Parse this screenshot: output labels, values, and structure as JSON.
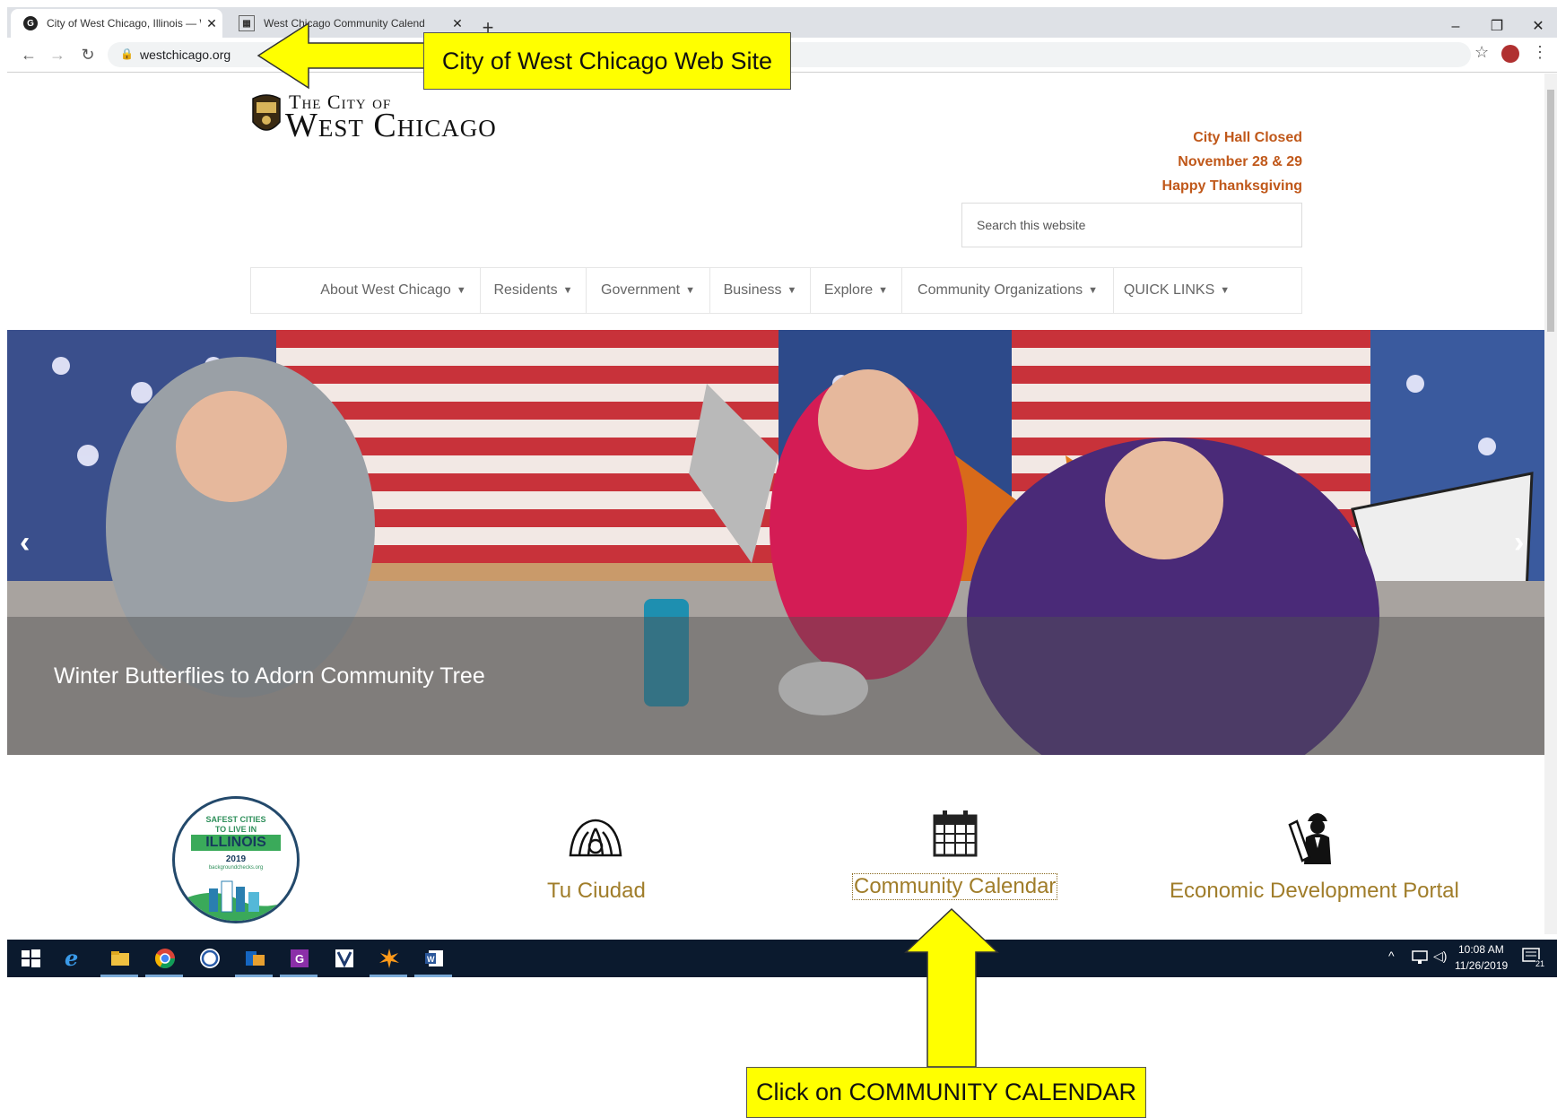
{
  "browser": {
    "tabs": [
      {
        "title": "City of West Chicago, Illinois — W",
        "active": true
      },
      {
        "title": "West Chicago Community Calend",
        "active": false
      }
    ],
    "new_tab": "+",
    "url": "westchicago.org",
    "window_controls": {
      "minimize": "–",
      "restore": "❐",
      "close": "✕"
    }
  },
  "site": {
    "logo_line1": "The City of",
    "logo_line2": "West Chicago",
    "notice": [
      "City Hall Closed",
      "November 28 & 29",
      "Happy Thanksgiving"
    ],
    "search_placeholder": "Search this website",
    "nav": [
      "About West Chicago",
      "Residents",
      "Government",
      "Business",
      "Explore",
      "Community Organizations",
      "QUICK LINKS"
    ],
    "hero_caption": "Winter Butterflies to Adorn Community Tree",
    "badge": {
      "line1": "SAFEST CITIES",
      "line2": "TO LIVE IN",
      "line3": "ILLINOIS",
      "year": "2019",
      "source": "backgroundchecks.org"
    },
    "features": [
      {
        "label": "Tu Ciudad",
        "icon": "turkey-icon"
      },
      {
        "label": "Community Calendar",
        "icon": "calendar-icon"
      },
      {
        "label": "Economic Development Portal",
        "icon": "worker-icon"
      }
    ]
  },
  "taskbar": {
    "time": "10:08 AM",
    "date": "11/26/2019",
    "notifications": "21"
  },
  "annotations": {
    "top_callout": "City of West Chicago Web Site",
    "bottom_callout": "Click on COMMUNITY CALENDAR"
  },
  "colors": {
    "accent_gold": "#a07d2a",
    "notice_orange": "#c0581a",
    "callout_yellow": "#ffff00",
    "taskbar": "#0b1a2e"
  }
}
